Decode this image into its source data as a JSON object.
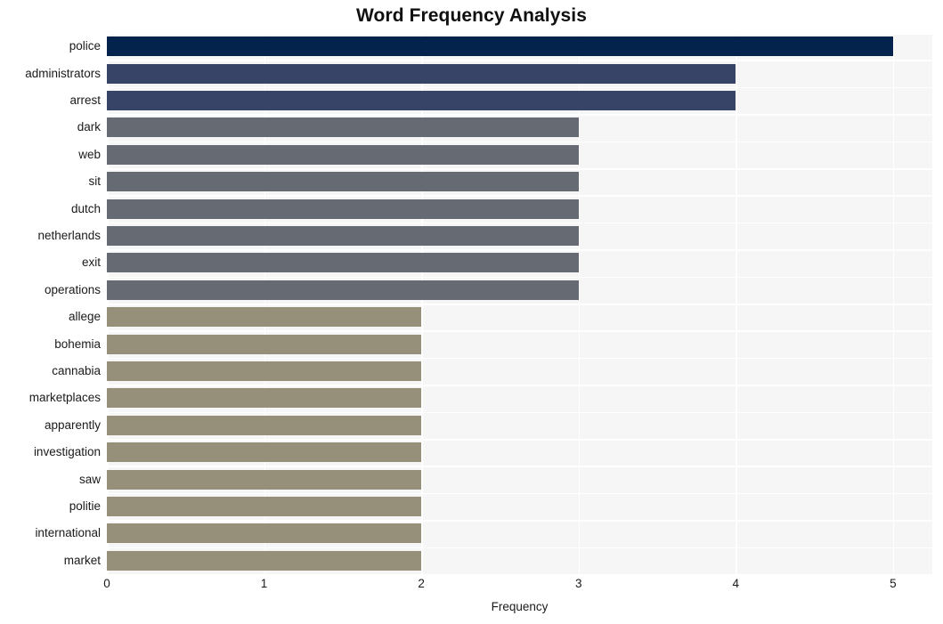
{
  "chart_data": {
    "type": "bar",
    "orientation": "horizontal",
    "title": "Word Frequency Analysis",
    "xlabel": "Frequency",
    "ylabel": "",
    "xlim": [
      0,
      5.25
    ],
    "xticks": [
      0,
      1,
      2,
      3,
      4,
      5
    ],
    "xtick_labels": [
      "0",
      "1",
      "2",
      "3",
      "4",
      "5"
    ],
    "grid": true,
    "legend": null,
    "categories": [
      "police",
      "administrators",
      "arrest",
      "dark",
      "web",
      "sit",
      "dutch",
      "netherlands",
      "exit",
      "operations",
      "allege",
      "bohemia",
      "cannabia",
      "marketplaces",
      "apparently",
      "investigation",
      "saw",
      "politie",
      "international",
      "market"
    ],
    "values": [
      5,
      4,
      4,
      3,
      3,
      3,
      3,
      3,
      3,
      3,
      2,
      2,
      2,
      2,
      2,
      2,
      2,
      2,
      2,
      2
    ],
    "bar_colors": [
      "#04234c",
      "#374468",
      "#374468",
      "#666a73",
      "#666a73",
      "#666a73",
      "#666a73",
      "#666a73",
      "#666a73",
      "#666a73",
      "#968f79",
      "#968f79",
      "#968f79",
      "#968f79",
      "#968f79",
      "#968f79",
      "#968f79",
      "#968f79",
      "#968f79",
      "#968f79"
    ]
  },
  "style": {
    "plot_background": "#f6f6f7",
    "grid_color": "#ffffff",
    "figure_background": "#ffffff",
    "text_color": "#1a1a1a",
    "title_color": "#101010"
  }
}
